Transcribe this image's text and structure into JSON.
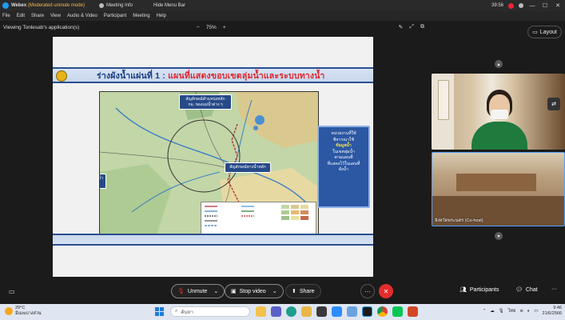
{
  "titlebar": {
    "app": "Webex",
    "mode": "(Moderated unmute mode)",
    "meeting_info": "Meeting Info",
    "hide_menu": "Hide Menu Bar",
    "timer": "39:56"
  },
  "menu": [
    "File",
    "Edit",
    "Share",
    "View",
    "Audio & Video",
    "Participant",
    "Meeting",
    "Help"
  ],
  "viewbar": {
    "label": "Viewing Tonlesab's application(s)",
    "zoom_minus": "−",
    "zoom": "75%",
    "zoom_plus": "+"
  },
  "layout_label": "Layout",
  "slide": {
    "title_part1": "ร่างผังน้ำแผ่นที่ 1 :",
    "title_part2": " แผนที่แสดงขอบเขตลุ่มน้ำและระบบทางน้ำ",
    "callout_top": "สัญลักษณ์ตำแหน่งหลัก กม. ของแม่น้ำต่าง ๆ",
    "callout_mid": "สัญลักษณ์ทางน้ำหลัก",
    "callout_left": "สัญลักษณ์ขอบเขตลุ่มน้ำ การไหลของน้ำ",
    "side_line1": "หน่วยงานที่ใช้",
    "side_line2": "พิจารณาใช้",
    "side_line3": "ข้อมูลน้ำ",
    "side_line4": "ในเขตลุ่มน้ำ",
    "side_line5": "ตามแผนที่",
    "side_line6": "ที่แสดงไว้ในแผนที่",
    "side_line7": "ผังน้ำ"
  },
  "videos": [
    {
      "name": ""
    },
    {
      "name": "จังหวัดพระนคร (Co-host)"
    }
  ],
  "controls": {
    "unmute": "Unmute",
    "stop_video": "Stop video",
    "share": "Share",
    "more": "···",
    "participants": "Participants",
    "chat": "Chat"
  },
  "taskbar": {
    "temp": "29°C",
    "weather": "มีเมฆบางส่วน",
    "search_placeholder": "ค้นหา",
    "lang": "ไทย",
    "time": "9:46",
    "date": "21/6/2566"
  },
  "colors": {
    "accent": "#1d9bf0",
    "end_call": "#e42c2c",
    "slide_title_blue": "#123a84",
    "slide_title_red": "#e2232a",
    "side_box": "#2b57a3"
  }
}
